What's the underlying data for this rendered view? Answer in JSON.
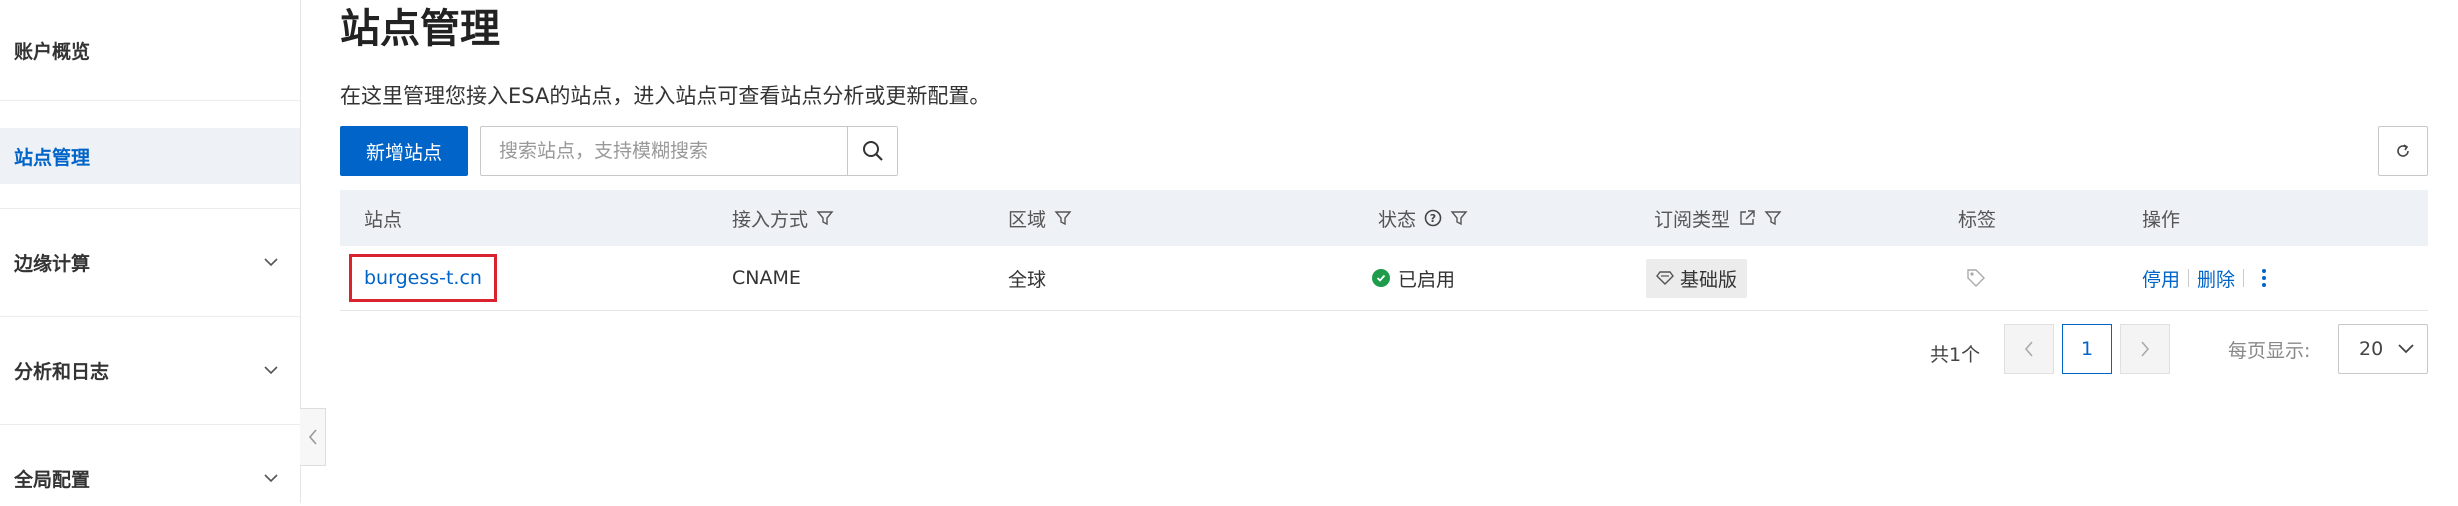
{
  "sidebar": {
    "items": [
      {
        "label": "账户概览",
        "active": false,
        "expandable": false
      },
      {
        "label": "站点管理",
        "active": true,
        "expandable": false
      },
      {
        "label": "边缘计算",
        "active": false,
        "expandable": true
      },
      {
        "label": "分析和日志",
        "active": false,
        "expandable": true
      },
      {
        "label": "全局配置",
        "active": false,
        "expandable": true
      }
    ]
  },
  "page": {
    "title": "站点管理",
    "description": "在这里管理您接入ESA的站点，进入站点可查看站点分析或更新配置。"
  },
  "toolbar": {
    "add_label": "新增站点",
    "search_placeholder": "搜索站点，支持模糊搜索"
  },
  "table": {
    "columns": {
      "site": "站点",
      "access": "接入方式",
      "region": "区域",
      "status": "状态",
      "plan": "订阅类型",
      "tags": "标签",
      "actions": "操作"
    },
    "rows": [
      {
        "site": "burgess-t.cn",
        "access": "CNAME",
        "region": "全球",
        "status": "已启用",
        "plan": "基础版",
        "actions": {
          "disable": "停用",
          "delete": "删除"
        }
      }
    ]
  },
  "pagination": {
    "total_text": "共1个",
    "current_page": "1",
    "per_page_label": "每页显示:",
    "per_page_value": "20"
  },
  "colors": {
    "accent": "#0064c8",
    "status_ok": "#1e9c4c",
    "highlight_box": "#d9232e"
  }
}
